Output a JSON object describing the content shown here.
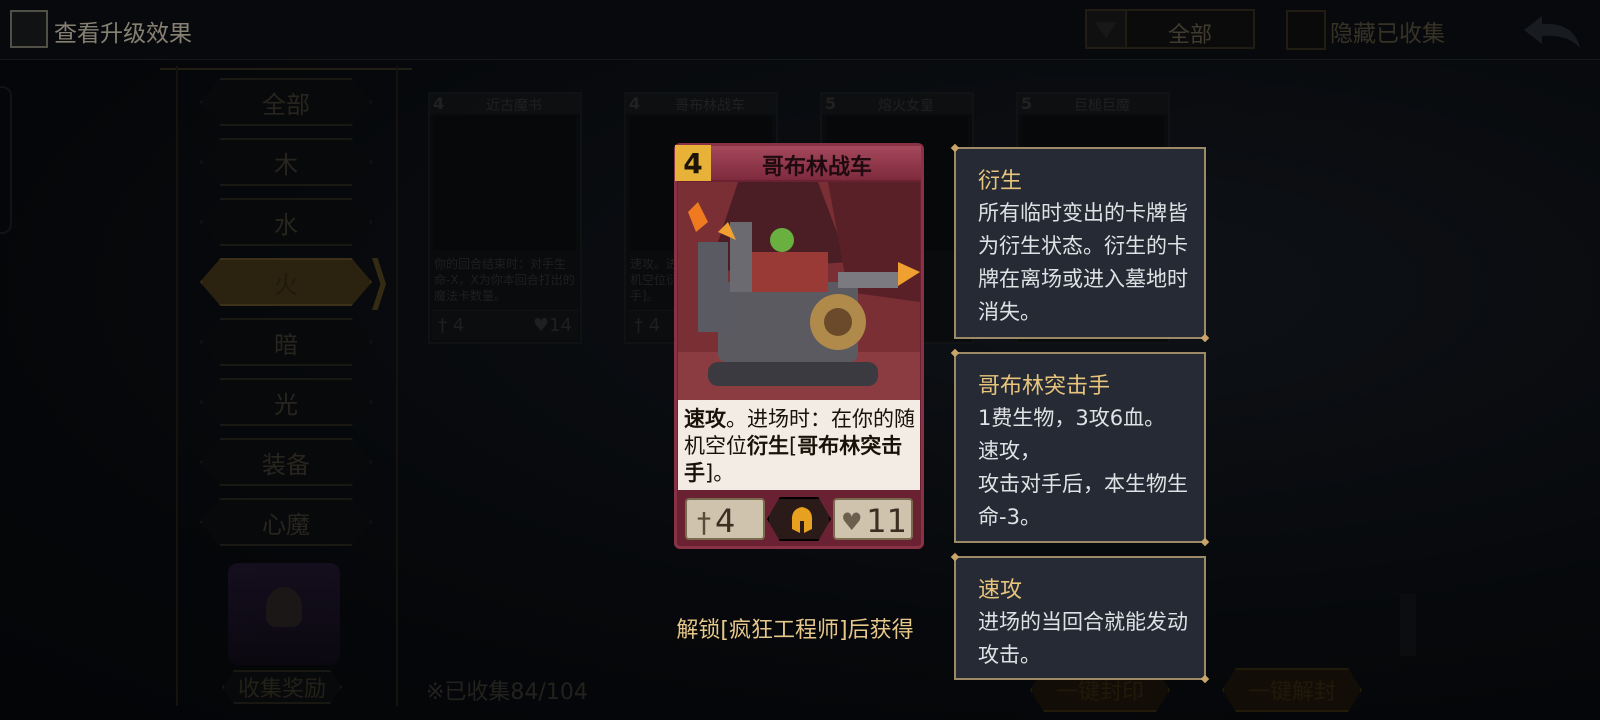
{
  "topbar": {
    "upgrade_label": "查看升级效果",
    "filter_value": "全部",
    "hide_label": "隐藏已收集"
  },
  "categories": [
    {
      "label": "全部",
      "active": false
    },
    {
      "label": "木",
      "active": false
    },
    {
      "label": "水",
      "active": false
    },
    {
      "label": "火",
      "active": true
    },
    {
      "label": "暗",
      "active": false
    },
    {
      "label": "光",
      "active": false
    },
    {
      "label": "装备",
      "active": false
    },
    {
      "label": "心魔",
      "active": false
    }
  ],
  "reward_label": "收集奖励",
  "background_cards": [
    {
      "cost": "4",
      "name": "近古魔书",
      "text": "你的回合结束时：对手生命-X，X为你本回合打出的魔法卡数量。",
      "atk": "4",
      "hp": "14"
    },
    {
      "cost": "4",
      "name": "哥布林战车",
      "text": "速攻。进场时：在你的随机空位衍生[哥布林突击手]。",
      "atk": "4",
      "hp": "11"
    },
    {
      "cost": "5",
      "name": "熔火女皇",
      "text": "",
      "atk": "",
      "hp": ""
    },
    {
      "cost": "5",
      "name": "巨槌巨魔",
      "text": "",
      "atk": "",
      "hp": ""
    }
  ],
  "collected": "※已收集84/104",
  "buttons": {
    "seal_all": "一键封印",
    "unseal_all": "一键解封"
  },
  "main_card": {
    "cost": "4",
    "name": "哥布林战车",
    "desc_1": "速攻",
    "desc_2": "。进场时：在你的随机空位",
    "desc_3": "衍生",
    "desc_4": "[",
    "desc_5": "哥布林突击手",
    "desc_6": "]。",
    "attack": "4",
    "health": "11",
    "class_icon": "helmet-icon"
  },
  "unlock_text": "解锁[疯狂工程师]后获得",
  "tooltips": [
    {
      "title": "衍生",
      "body": "所有临时变出的卡牌皆为衍生状态。衍生的卡牌在离场或进入墓地时消失。"
    },
    {
      "title": "哥布林突击手",
      "body_lines": [
        "1费生物，3攻6血。",
        "速攻，",
        "攻击对手后，本生物生命-3。"
      ]
    },
    {
      "title": "速攻",
      "body": "进场的当回合就能发动攻击。"
    }
  ],
  "colors": {
    "accent_gold": "#e8c47c",
    "card_crimson": "#7e2a3d",
    "tooltip_bg": "#252a34"
  }
}
